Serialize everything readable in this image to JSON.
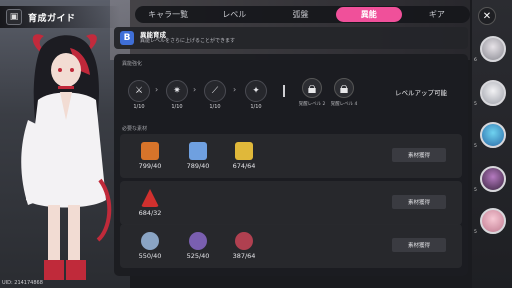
{
  "header": {
    "title": "育成ガイド",
    "icon": "guide-book-icon"
  },
  "tabs": [
    {
      "label": "キャラ一覧",
      "active": false
    },
    {
      "label": "レベル",
      "active": false
    },
    {
      "label": "弧盤",
      "active": false
    },
    {
      "label": "異能",
      "active": true
    },
    {
      "label": "ギア",
      "active": false
    }
  ],
  "close": {
    "icon": "close-icon"
  },
  "skill": {
    "badge": "B",
    "title": "異能育成",
    "subtitle": "異能レベルをさらに上げることができます"
  },
  "strengthen": {
    "label": "異能強化",
    "nodes": [
      {
        "icon": "claw-icon",
        "count": "1/10"
      },
      {
        "icon": "burst-icon",
        "count": "1/10"
      },
      {
        "icon": "slash-icon",
        "count": "1/10"
      },
      {
        "icon": "star-slash-icon",
        "count": "1/10"
      }
    ],
    "locks": [
      {
        "label": "覚醒レベル 2",
        "icon": "lock-icon"
      },
      {
        "label": "覚醒レベル 4",
        "icon": "lock-icon"
      }
    ],
    "levelup": "レベルアップ可能"
  },
  "materials": {
    "label": "必要な素材",
    "rows": [
      {
        "items": [
          {
            "icon": "orange-cube-icon",
            "count": "799/40",
            "color": "#d7742a"
          },
          {
            "icon": "blue-cube-icon",
            "count": "789/40",
            "color": "#6fa0e0"
          },
          {
            "icon": "gold-cube-icon",
            "count": "674/64",
            "color": "#e0b83a"
          }
        ],
        "button": "素材獲得"
      },
      {
        "items": [
          {
            "icon": "red-crystal-icon",
            "count": "684/32",
            "color": "#d0302e"
          }
        ],
        "button": "素材獲得"
      },
      {
        "items": [
          {
            "icon": "silver-orb-icon",
            "count": "550/40",
            "color": "#8aa4c4"
          },
          {
            "icon": "purple-orb-icon",
            "count": "525/40",
            "color": "#7a5fb0"
          },
          {
            "icon": "red-orb-icon",
            "count": "387/64",
            "color": "#b04050"
          }
        ],
        "button": "素材獲得"
      }
    ]
  },
  "avatars": [
    {
      "icon": "avatar-silver-hair",
      "num": "6"
    },
    {
      "icon": "avatar-white-hair",
      "num": "5"
    },
    {
      "icon": "avatar-blue-hair",
      "num": "5"
    },
    {
      "icon": "avatar-dark-hair",
      "num": "5"
    },
    {
      "icon": "avatar-pink-hair",
      "num": "5"
    }
  ],
  "uid": "UID: 214174868"
}
